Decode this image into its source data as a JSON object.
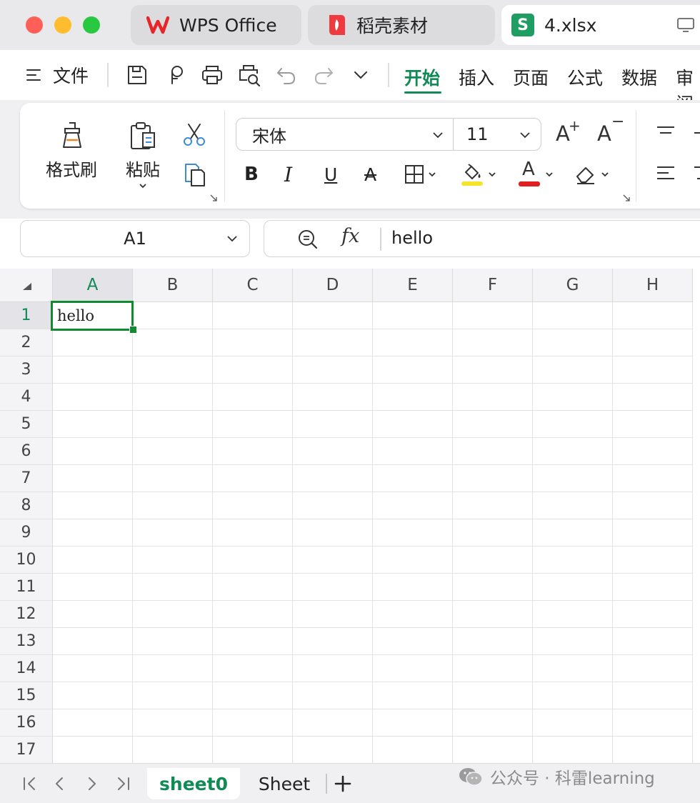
{
  "titlebar": {
    "tabs": [
      {
        "label": "WPS Office"
      },
      {
        "label": "稻壳素材"
      },
      {
        "label": "4.xlsx",
        "icon_letter": "S"
      }
    ]
  },
  "menubar": {
    "file_label": "文件",
    "ribbon_tabs": [
      "开始",
      "插入",
      "页面",
      "公式",
      "数据",
      "审阅"
    ],
    "active_tab": "开始"
  },
  "ribbon": {
    "format_painter_label": "格式刷",
    "paste_label": "粘贴",
    "font_name": "宋体",
    "font_size": "11",
    "bold_glyph": "B",
    "italic_glyph": "I",
    "underline_glyph": "U",
    "strike_glyph": "A",
    "font_color_glyph": "A",
    "increase_font_glyph": "A",
    "decrease_font_glyph": "A",
    "fill_color": "#f5e52a",
    "font_color": "#e02020"
  },
  "namebox": {
    "value": "A1"
  },
  "formula": {
    "fx_label": "fx",
    "value": "hello"
  },
  "grid": {
    "columns": [
      "A",
      "B",
      "C",
      "D",
      "E",
      "F",
      "G",
      "H"
    ],
    "rows": [
      "1",
      "2",
      "3",
      "4",
      "5",
      "6",
      "7",
      "8",
      "9",
      "10",
      "11",
      "12",
      "13",
      "14",
      "15",
      "16",
      "17"
    ],
    "cells": {
      "A1": "hello"
    },
    "selected_cell": "A1"
  },
  "sheets": {
    "tabs": [
      "sheet0",
      "Sheet"
    ],
    "active": "sheet0"
  },
  "watermark": {
    "text": "公众号 · 科雷learning"
  },
  "colors": {
    "accent": "#128a58",
    "selection": "#128a30"
  }
}
